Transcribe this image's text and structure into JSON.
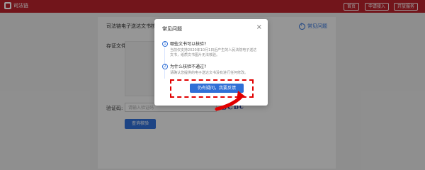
{
  "header": {
    "brand": "司法链",
    "buttons": [
      "首页",
      "申请接入",
      "开放服务"
    ]
  },
  "page": {
    "title": "司法链电子送达文书核验",
    "help_link": "常见问题",
    "file_label": "存证文件:",
    "code_label": "验证码:",
    "code_placeholder": "请输入验证码",
    "captcha": "bCbc",
    "query_button": "查询核验"
  },
  "modal": {
    "title": "常见问题",
    "close": "×",
    "questions": [
      {
        "num": "1",
        "question": "哪些文书可以核验?",
        "answer": "当前仅支持2020年10月1日后产生的人民法院电子送达文书，纸质文书图片无法核验。"
      },
      {
        "num": "2",
        "question": "为什么核验不通过?",
        "answer": "请确认您提供的电子送达文书没有进行任何修改。"
      }
    ],
    "feedback_button": "仍有疑问，我要反馈"
  },
  "annotation": {
    "highlight_color": "#e00000"
  }
}
